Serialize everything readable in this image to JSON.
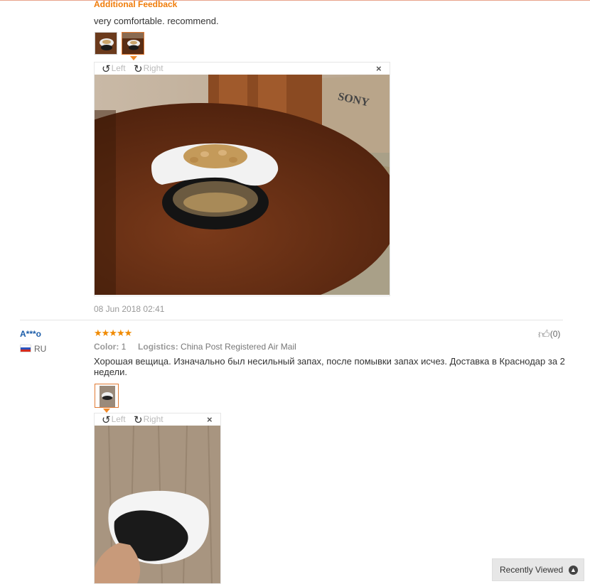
{
  "review1": {
    "additional_feedback_title": "Additional Feedback",
    "feedback_text": "very comfortable. recommend.",
    "viewer": {
      "rotate_left": "Left",
      "rotate_right": "Right",
      "close": "×"
    },
    "date": "08 Jun 2018 02:41"
  },
  "review2": {
    "user": "A***o",
    "country": "RU",
    "stars": "★★★★★",
    "color_label": "Color:",
    "color_value": "1",
    "logistics_label": "Logistics:",
    "logistics_value": "China Post Registered Air Mail",
    "helpful_count": "(0)",
    "text_line1": "Хорошая вещица. Изначально был несильный запах, после помывки запах исчез. Доставка в Краснодар за 2",
    "text_line2": "недели.",
    "viewer": {
      "rotate_left": "Left",
      "rotate_right": "Right",
      "close": "×"
    }
  },
  "recently_viewed": {
    "label": "Recently Viewed"
  },
  "icons": {
    "rotate_left": "rotate-left-icon",
    "rotate_right": "rotate-right-icon",
    "thumbs_up": "thumbs-up-icon",
    "chevron_up": "chevron-up-icon"
  },
  "colors": {
    "accent": "#f07c0a",
    "link": "#1b5ca8"
  }
}
